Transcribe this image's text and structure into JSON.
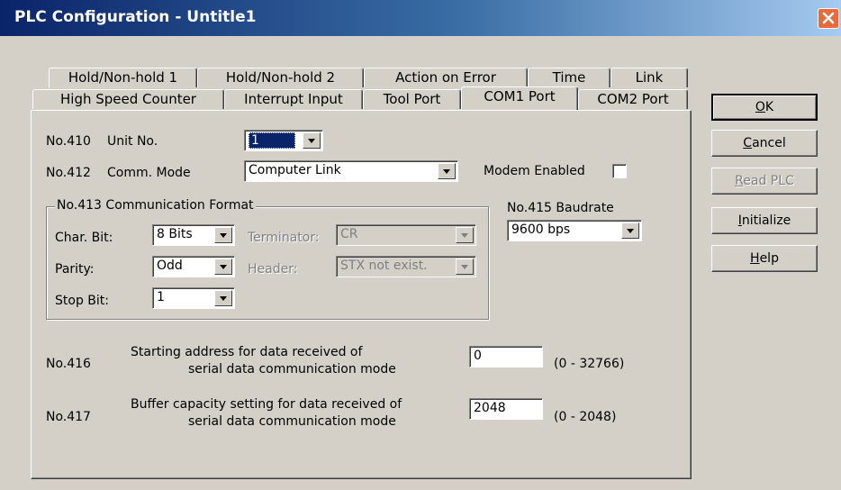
{
  "window": {
    "title": "PLC Configuration - Untitle1"
  },
  "icons": {
    "close": "close-icon"
  },
  "tabs_row1": [
    "Hold/Non-hold 1",
    "Hold/Non-hold 2",
    "Action on Error",
    "Time",
    "Link"
  ],
  "tabs_row2": [
    "High Speed Counter",
    "Interrupt Input",
    "Tool Port",
    "COM1 Port",
    "COM2 Port"
  ],
  "active_tab": "COM1 Port",
  "unit_no": {
    "code": "No.410",
    "label": "Unit No.",
    "value": "1"
  },
  "comm_mode": {
    "code": "No.412",
    "label": "Comm. Mode",
    "value": "Computer Link"
  },
  "modem": {
    "label": "Modem Enabled",
    "checked": false
  },
  "comm_format": {
    "group_label": "No.413 Communication Format",
    "char_bit": {
      "label": "Char. Bit:",
      "value": "8 Bits"
    },
    "parity": {
      "label": "Parity:",
      "value": "Odd"
    },
    "stop_bit": {
      "label": "Stop Bit:",
      "value": "1"
    },
    "terminator": {
      "label": "Terminator:",
      "value": "CR"
    },
    "header": {
      "label": "Header:",
      "value": "STX not exist."
    }
  },
  "baudrate": {
    "label": "No.415 Baudrate",
    "value": "9600 bps"
  },
  "start_address": {
    "code": "No.416",
    "desc_line1": "Starting address for data received of",
    "desc_line2": "serial data communication mode",
    "value": "0",
    "range": "(0 - 32766)"
  },
  "buffer_capacity": {
    "code": "No.417",
    "desc_line1": "Buffer capacity setting for data received of",
    "desc_line2": "serial data communication mode",
    "value": "2048",
    "range": "(0 - 2048)"
  },
  "buttons": {
    "ok": {
      "mnemonic": "O",
      "rest": "K"
    },
    "cancel": {
      "mnemonic": "C",
      "rest": "ancel"
    },
    "read_plc": {
      "mnemonic": "R",
      "rest": "ead PLC"
    },
    "initialize": {
      "mnemonic": "I",
      "rest": "nitialize"
    },
    "help": {
      "mnemonic": "H",
      "rest": "elp"
    }
  }
}
